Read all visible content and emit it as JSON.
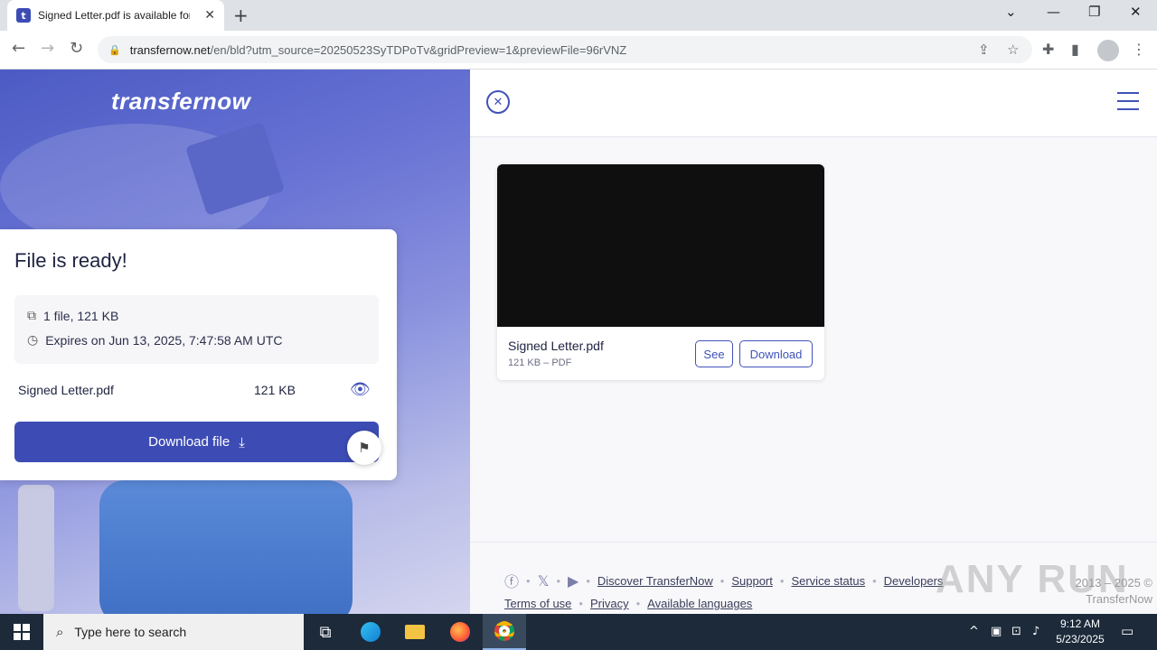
{
  "browser": {
    "tab_title": "Signed Letter.pdf is available for",
    "tab_favicon": "t",
    "url_domain": "transfernow.net",
    "url_path": "/en/bld?utm_source=20250523SyTDPoTv&gridPreview=1&previewFile=96rVNZ"
  },
  "brand": {
    "logo_text": "transfernow",
    "accent": "#3d4cb5"
  },
  "card": {
    "title": "File is ready!",
    "files_summary": "1 file, 121 KB",
    "expires": "Expires on Jun 13, 2025, 7:47:58 AM UTC",
    "file_name": "Signed Letter.pdf",
    "file_size": "121 KB",
    "download_label": "Download file"
  },
  "preview": {
    "file_name": "Signed Letter.pdf",
    "meta": "121 KB – PDF",
    "see_label": "See",
    "download_label": "Download"
  },
  "footer": {
    "links_row1": [
      "Discover TransferNow",
      "Support",
      "Service status",
      "Developers"
    ],
    "links_row2": [
      "Terms of use",
      "Privacy",
      "Available languages"
    ],
    "copyright_line1": "2013 – 2025 ©",
    "copyright_line2": "TransferNow",
    "watermark": "ANY RUN"
  },
  "taskbar": {
    "search_placeholder": "Type here to search",
    "time": "9:12 AM",
    "date": "5/23/2025"
  }
}
